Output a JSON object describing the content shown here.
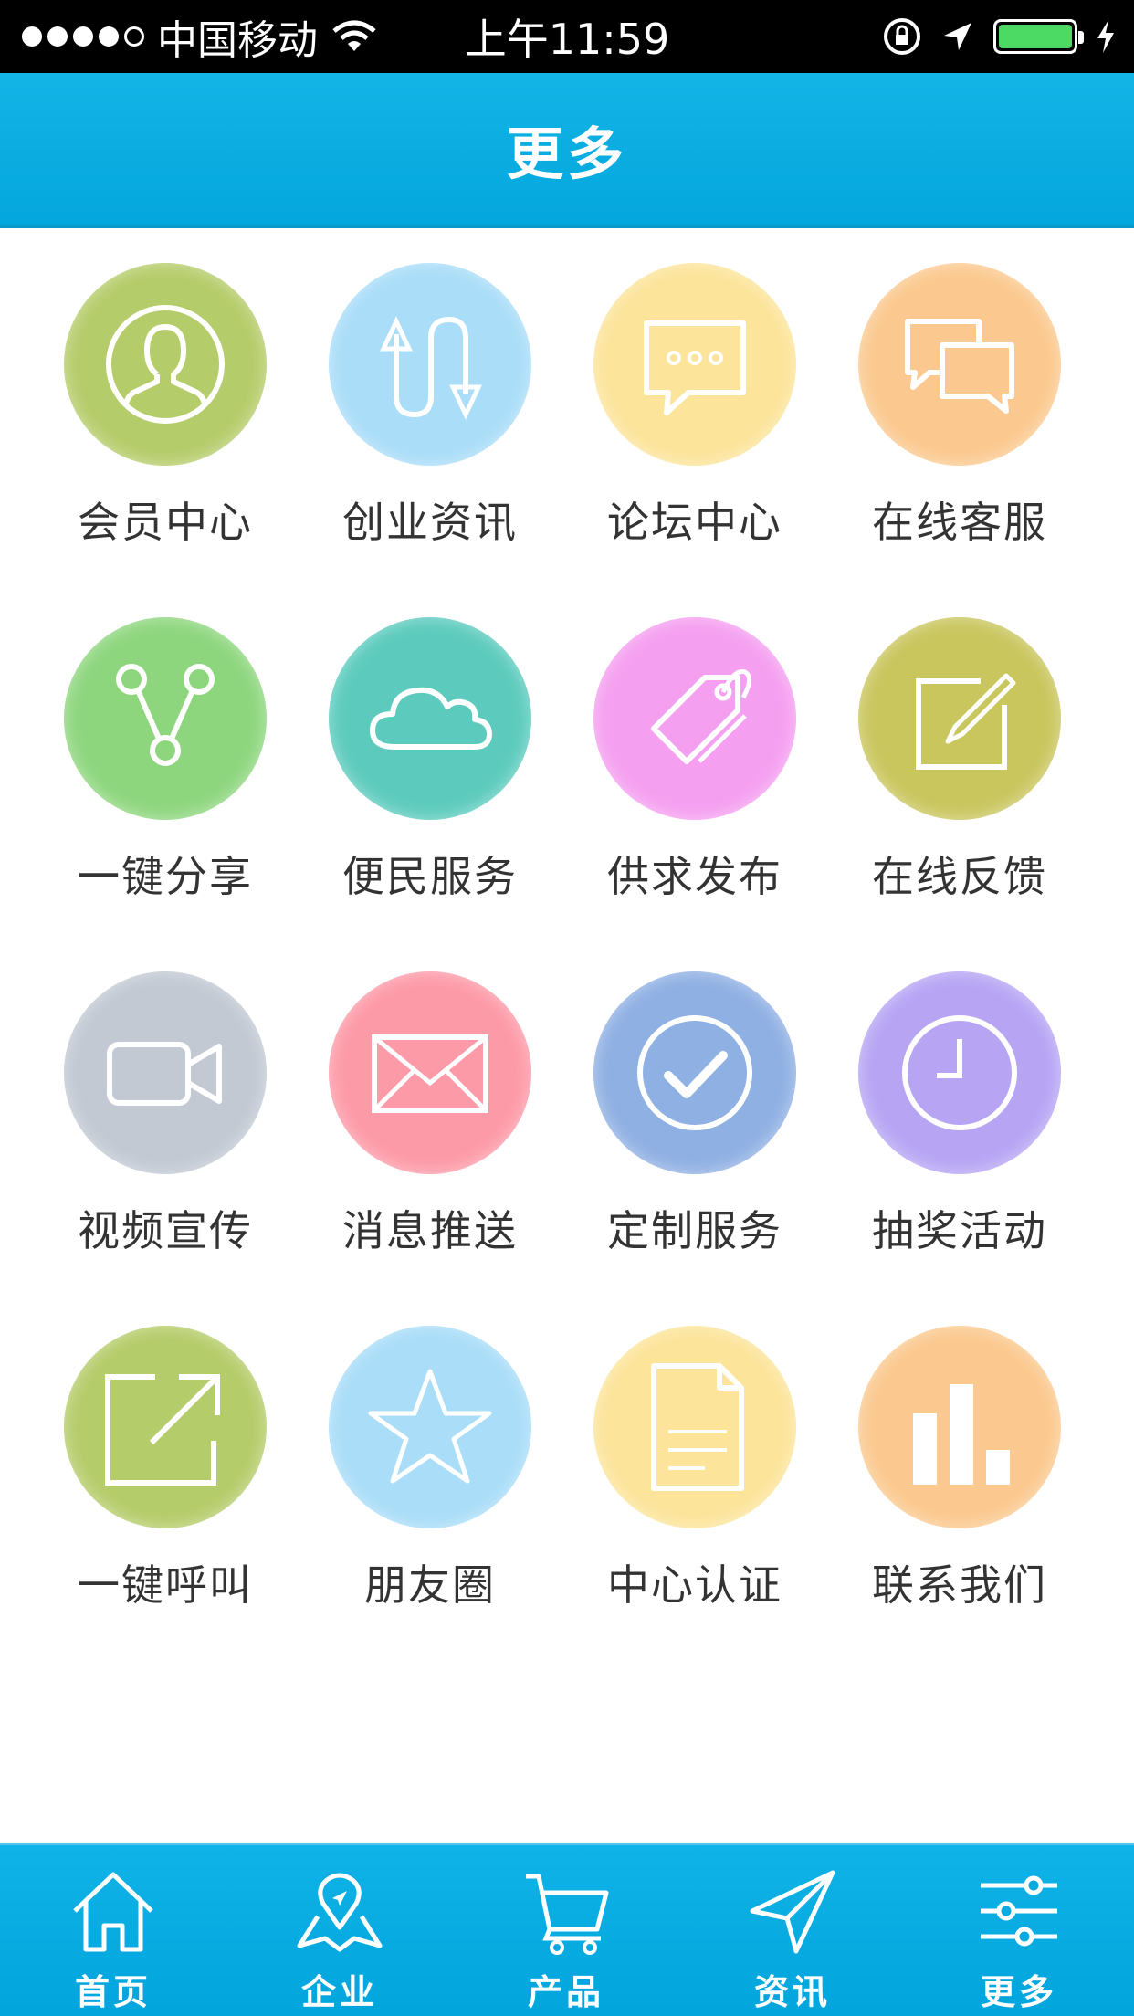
{
  "status_bar": {
    "carrier": "中国移动",
    "time": "上午11:59",
    "battery_color": "#4cd964"
  },
  "header": {
    "title": "更多"
  },
  "grid_items": [
    {
      "label": "会员中心",
      "icon": "user-icon",
      "color": "#b5cc6a"
    },
    {
      "label": "创业资讯",
      "icon": "route-icon",
      "color": "#a9ddf8"
    },
    {
      "label": "论坛中心",
      "icon": "chat-bubble-icon",
      "color": "#fce49a"
    },
    {
      "label": "在线客服",
      "icon": "chat-bubbles-icon",
      "color": "#fbc98f"
    },
    {
      "label": "一键分享",
      "icon": "share-icon",
      "color": "#8ed67e"
    },
    {
      "label": "便民服务",
      "icon": "cloud-icon",
      "color": "#5ccbbd"
    },
    {
      "label": "供求发布",
      "icon": "tag-icon",
      "color": "#f59ff0"
    },
    {
      "label": "在线反馈",
      "icon": "edit-icon",
      "color": "#c9c65e"
    },
    {
      "label": "视频宣传",
      "icon": "video-icon",
      "color": "#c2c9d3"
    },
    {
      "label": "消息推送",
      "icon": "mail-icon",
      "color": "#fd9aa8"
    },
    {
      "label": "定制服务",
      "icon": "check-circle-icon",
      "color": "#8fb0e3"
    },
    {
      "label": "抽奖活动",
      "icon": "clock-icon",
      "color": "#b7a5f4"
    },
    {
      "label": "一键呼叫",
      "icon": "external-link-icon",
      "color": "#b5cc6a"
    },
    {
      "label": "朋友圈",
      "icon": "star-icon",
      "color": "#a9ddf8"
    },
    {
      "label": "中心认证",
      "icon": "document-icon",
      "color": "#fce49a"
    },
    {
      "label": "联系我们",
      "icon": "bar-chart-icon",
      "color": "#fbc98f"
    }
  ],
  "tabbar": {
    "items": [
      {
        "label": "首页",
        "icon": "home-icon"
      },
      {
        "label": "企业",
        "icon": "map-pin-icon"
      },
      {
        "label": "产品",
        "icon": "cart-icon"
      },
      {
        "label": "资讯",
        "icon": "send-icon"
      },
      {
        "label": "更多",
        "icon": "sliders-icon"
      }
    ]
  }
}
